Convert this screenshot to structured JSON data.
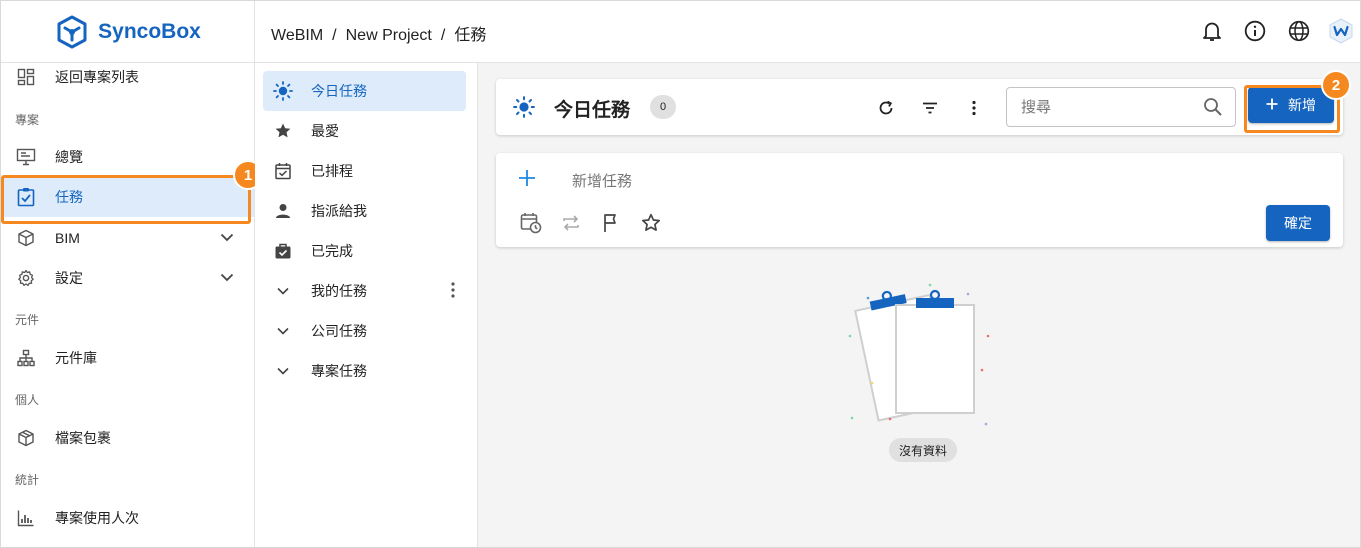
{
  "app": {
    "name": "SyncoBox",
    "brand_color": "#1565c0",
    "highlight_color": "#f5891f"
  },
  "sidebar": {
    "back": "返回專案列表",
    "section_project": "專案",
    "overview": "總覽",
    "tasks": "任務",
    "bim": "BIM",
    "settings": "設定",
    "section_components": "元件",
    "component_library": "元件庫",
    "section_personal": "個人",
    "file_package": "檔案包裹",
    "section_stats": "統計",
    "project_usage": "專案使用人次"
  },
  "header": {
    "breadcrumb": [
      "WeBIM",
      "New Project",
      "任務"
    ],
    "separator": "/",
    "icons": [
      "bell-icon",
      "info-icon",
      "globe-icon",
      "avatar"
    ]
  },
  "task_lists": {
    "items": [
      {
        "label": "今日任務",
        "icon": "sun-icon",
        "active": true
      },
      {
        "label": "最愛",
        "icon": "star-icon"
      },
      {
        "label": "已排程",
        "icon": "calendar-check-icon"
      },
      {
        "label": "指派給我",
        "icon": "person-icon"
      },
      {
        "label": "已完成",
        "icon": "briefcase-check-icon"
      },
      {
        "label": "我的任務",
        "icon": "chevron-down-icon"
      },
      {
        "label": "公司任務",
        "icon": "chevron-down-icon"
      },
      {
        "label": "專案任務",
        "icon": "chevron-down-icon"
      }
    ]
  },
  "main": {
    "title": "今日任務",
    "count": "0",
    "search_placeholder": "搜尋",
    "add_label": "新增",
    "new_task_placeholder": "新增任務",
    "confirm_label": "確定",
    "empty_label": "沒有資料"
  },
  "callouts": {
    "first": "1",
    "second": "2"
  }
}
